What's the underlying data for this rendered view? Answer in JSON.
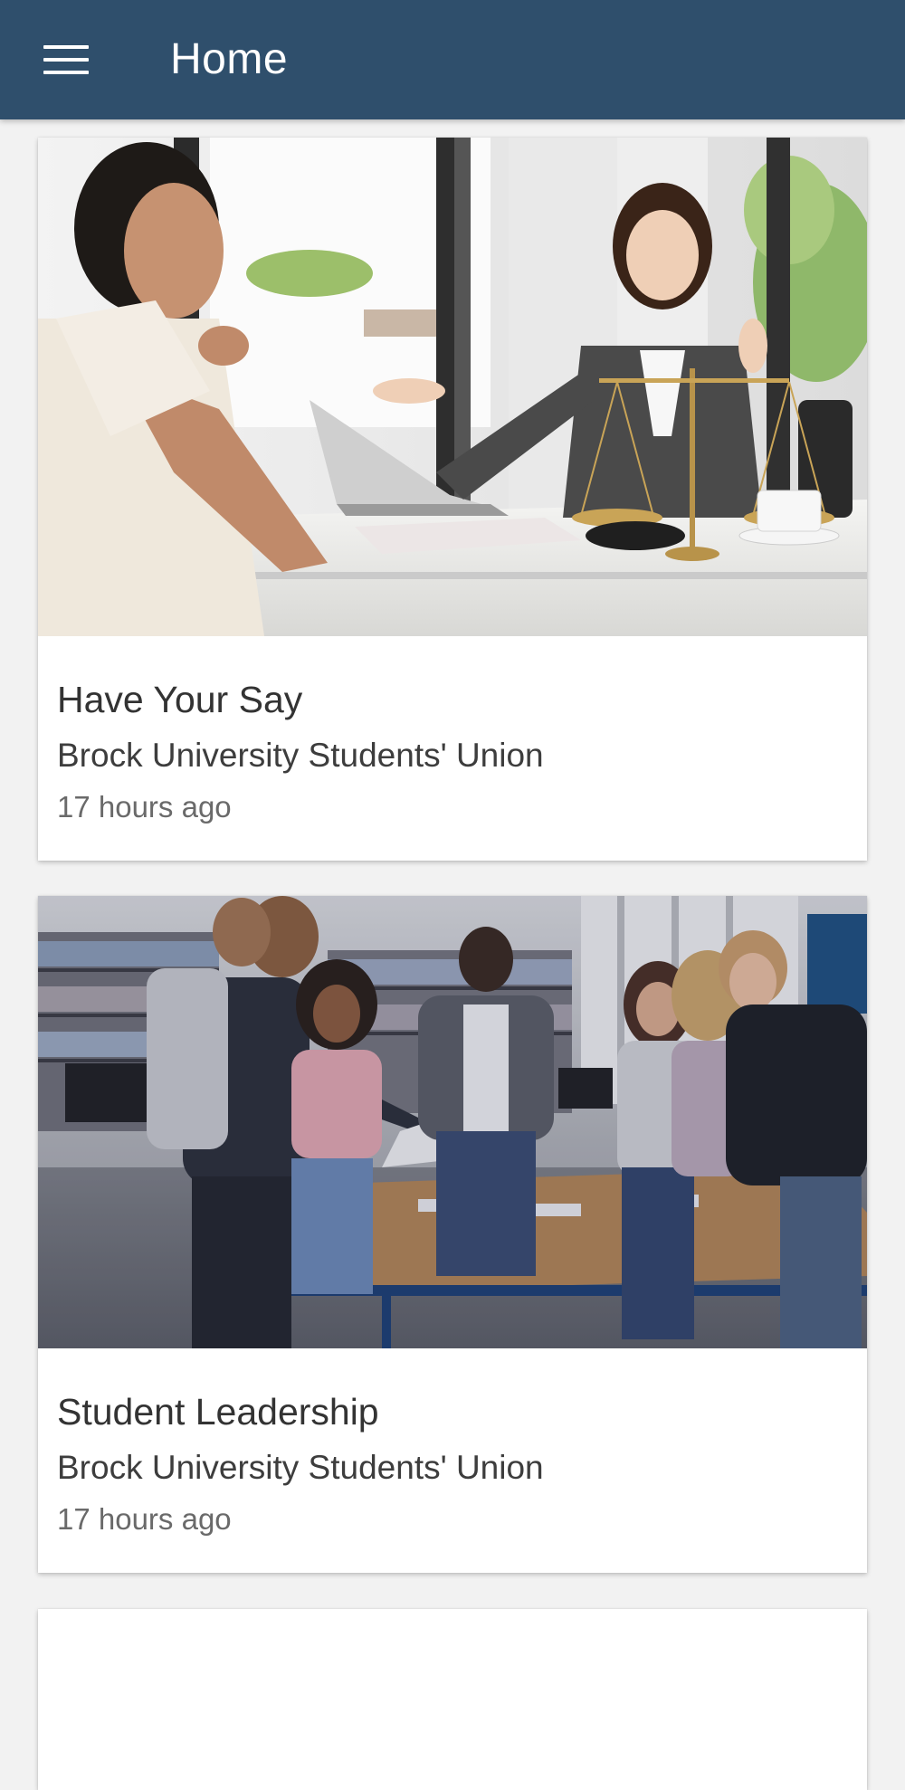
{
  "app_bar": {
    "title": "Home",
    "menu_icon": "hamburger-menu-icon",
    "color": "#2f4f6c"
  },
  "feed": {
    "cards": [
      {
        "image": "Two women talking across a desk with scales of justice and a laptop",
        "title": "Have Your Say",
        "organization": "Brock University Students' Union",
        "time": "17 hours ago"
      },
      {
        "image": "Group of students gathered around a table in a library",
        "title": "Student Leadership",
        "organization": "Brock University Students' Union",
        "time": "17 hours ago"
      }
    ]
  }
}
